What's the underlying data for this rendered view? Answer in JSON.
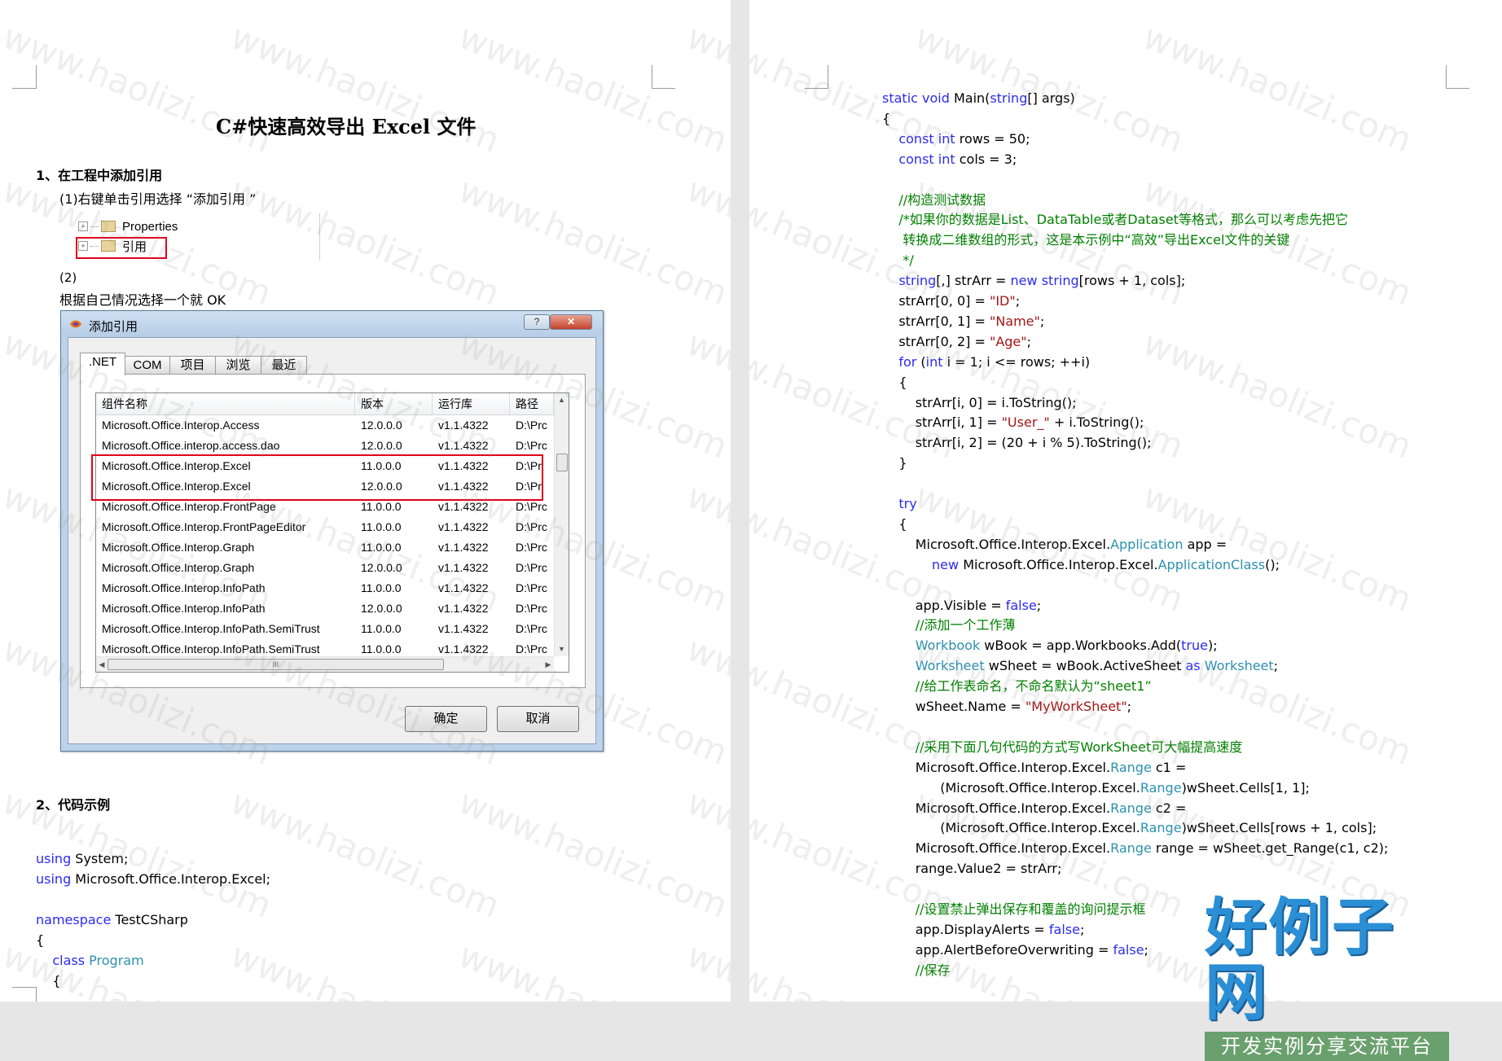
{
  "document": {
    "title": "C#快速高效导出 Excel 文件",
    "section1_heading": "1、在工程中添加引用",
    "step1_text": "(1)右键单击引用选择 “添加引用 ”",
    "tree_items": [
      "Properties",
      "引用"
    ],
    "step2_label": "(2)",
    "step2_text": "根据自己情况选择一个就 OK",
    "section2_heading": "2、代码示例"
  },
  "dialog": {
    "title": "添加引用",
    "help_glyph": "?",
    "close_glyph": "✕",
    "tabs": [
      ".NET",
      "COM",
      "项目",
      "浏览",
      "最近"
    ],
    "selected_tab": ".NET",
    "columns": [
      "组件名称",
      "版本",
      "运行库",
      "路径"
    ],
    "rows": [
      [
        "Microsoft.Office.Interop.Access",
        "12.0.0.0",
        "v1.1.4322",
        "D:\\Prc"
      ],
      [
        "Microsoft.Office.interop.access.dao",
        "12.0.0.0",
        "v1.1.4322",
        "D:\\Prc"
      ],
      [
        "Microsoft.Office.Interop.Excel",
        "11.0.0.0",
        "v1.1.4322",
        "D:\\Pr"
      ],
      [
        "Microsoft.Office.Interop.Excel",
        "12.0.0.0",
        "v1.1.4322",
        "D:\\Pr"
      ],
      [
        "Microsoft.Office.Interop.FrontPage",
        "11.0.0.0",
        "v1.1.4322",
        "D:\\Prc"
      ],
      [
        "Microsoft.Office.Interop.FrontPageEditor",
        "11.0.0.0",
        "v1.1.4322",
        "D:\\Prc"
      ],
      [
        "Microsoft.Office.Interop.Graph",
        "11.0.0.0",
        "v1.1.4322",
        "D:\\Prc"
      ],
      [
        "Microsoft.Office.Interop.Graph",
        "12.0.0.0",
        "v1.1.4322",
        "D:\\Prc"
      ],
      [
        "Microsoft.Office.Interop.InfoPath",
        "11.0.0.0",
        "v1.1.4322",
        "D:\\Prc"
      ],
      [
        "Microsoft.Office.Interop.InfoPath",
        "12.0.0.0",
        "v1.1.4322",
        "D:\\Prc"
      ],
      [
        "Microsoft.Office.Interop.InfoPath.SemiTrust",
        "11.0.0.0",
        "v1.1.4322",
        "D:\\Prc"
      ],
      [
        "Microsoft.Office.Interop.InfoPath.SemiTrust",
        "11.0.0.0",
        "v1.1.4322",
        "D:\\Prc"
      ]
    ],
    "ok_label": "确定",
    "cancel_label": "取消",
    "hscroll_grip": "III"
  },
  "colors": {
    "keyword": "#2b2bf0",
    "type": "#2b91af",
    "string": "#a31515",
    "comment": "#008000",
    "highlight_box": "#e0001a"
  },
  "code_left": [
    [
      [
        "using",
        "keyword"
      ],
      [
        " System;",
        ""
      ]
    ],
    [
      [
        "using",
        "keyword"
      ],
      [
        " Microsoft.Office.Interop.Excel;",
        ""
      ]
    ],
    [],
    [
      [
        "namespace",
        "keyword"
      ],
      [
        " TestCSharp",
        ""
      ]
    ],
    [
      [
        "{",
        ""
      ]
    ],
    [
      [
        "    ",
        ""
      ],
      [
        "class",
        "keyword"
      ],
      [
        " ",
        ""
      ],
      [
        "Program",
        "type"
      ]
    ],
    [
      [
        "    {",
        ""
      ]
    ]
  ],
  "code_right": [
    [
      [
        "static",
        "keyword"
      ],
      [
        " ",
        ""
      ],
      [
        "void",
        "keyword"
      ],
      [
        " Main(",
        ""
      ],
      [
        "string",
        "keyword"
      ],
      [
        "[] args)",
        ""
      ]
    ],
    [
      [
        "{",
        ""
      ]
    ],
    [
      [
        "    ",
        ""
      ],
      [
        "const",
        "keyword"
      ],
      [
        " ",
        ""
      ],
      [
        "int",
        "keyword"
      ],
      [
        " rows = 50;",
        ""
      ]
    ],
    [
      [
        "    ",
        ""
      ],
      [
        "const",
        "keyword"
      ],
      [
        " ",
        ""
      ],
      [
        "int",
        "keyword"
      ],
      [
        " cols = 3;",
        ""
      ]
    ],
    [],
    [
      [
        "    //构造测试数据",
        "comment"
      ]
    ],
    [
      [
        "    /*如果你的数据是List、DataTable或者Dataset等格式，那么可以考虑先把它",
        "comment"
      ]
    ],
    [
      [
        "     转换成二维数组的形式，这是本示例中“高效”导出Excel文件的关键",
        "comment"
      ]
    ],
    [
      [
        "     */",
        "comment"
      ]
    ],
    [
      [
        "    ",
        ""
      ],
      [
        "string",
        "keyword"
      ],
      [
        "[,] strArr = ",
        ""
      ],
      [
        "new",
        "keyword"
      ],
      [
        " ",
        ""
      ],
      [
        "string",
        "keyword"
      ],
      [
        "[rows + 1, cols];",
        ""
      ]
    ],
    [
      [
        "    strArr[0, 0] = ",
        ""
      ],
      [
        "\"ID\"",
        "string"
      ],
      [
        ";",
        ""
      ]
    ],
    [
      [
        "    strArr[0, 1] = ",
        ""
      ],
      [
        "\"Name\"",
        "string"
      ],
      [
        ";",
        ""
      ]
    ],
    [
      [
        "    strArr[0, 2] = ",
        ""
      ],
      [
        "\"Age\"",
        "string"
      ],
      [
        ";",
        ""
      ]
    ],
    [
      [
        "    ",
        ""
      ],
      [
        "for",
        "keyword"
      ],
      [
        " (",
        ""
      ],
      [
        "int",
        "keyword"
      ],
      [
        " i = 1; i <= rows; ++i)",
        ""
      ]
    ],
    [
      [
        "    {",
        ""
      ]
    ],
    [
      [
        "        strArr[i, 0] = i.ToString();",
        ""
      ]
    ],
    [
      [
        "        strArr[i, 1] = ",
        ""
      ],
      [
        "\"User_\"",
        "string"
      ],
      [
        " + i.ToString();",
        ""
      ]
    ],
    [
      [
        "        strArr[i, 2] = (20 + i % 5).ToString();",
        ""
      ]
    ],
    [
      [
        "    }",
        ""
      ]
    ],
    [],
    [
      [
        "    ",
        ""
      ],
      [
        "try",
        "keyword"
      ]
    ],
    [
      [
        "    {",
        ""
      ]
    ],
    [
      [
        "        Microsoft.Office.Interop.Excel.",
        ""
      ],
      [
        "Application",
        "type"
      ],
      [
        " app =",
        ""
      ]
    ],
    [
      [
        "            ",
        ""
      ],
      [
        "new",
        "keyword"
      ],
      [
        " Microsoft.Office.Interop.Excel.",
        ""
      ],
      [
        "ApplicationClass",
        "type"
      ],
      [
        "();",
        ""
      ]
    ],
    [],
    [
      [
        "        app.Visible = ",
        ""
      ],
      [
        "false",
        "keyword"
      ],
      [
        ";",
        ""
      ]
    ],
    [
      [
        "        //添加一个工作薄",
        "comment"
      ]
    ],
    [
      [
        "        ",
        ""
      ],
      [
        "Workbook",
        "type"
      ],
      [
        " wBook = app.Workbooks.Add(",
        ""
      ],
      [
        "true",
        "keyword"
      ],
      [
        ");",
        ""
      ]
    ],
    [
      [
        "        ",
        ""
      ],
      [
        "Worksheet",
        "type"
      ],
      [
        " wSheet = wBook.ActiveSheet ",
        ""
      ],
      [
        "as",
        "keyword"
      ],
      [
        " ",
        ""
      ],
      [
        "Worksheet",
        "type"
      ],
      [
        ";",
        ""
      ]
    ],
    [
      [
        "        //给工作表命名，不命名默认为“sheet1”",
        "comment"
      ]
    ],
    [
      [
        "        wSheet.Name = ",
        ""
      ],
      [
        "\"MyWorkSheet\"",
        "string"
      ],
      [
        ";",
        ""
      ]
    ],
    [],
    [
      [
        "        //采用下面几句代码的方式写WorkSheet可大幅提高速度",
        "comment"
      ]
    ],
    [
      [
        "        Microsoft.Office.Interop.Excel.",
        ""
      ],
      [
        "Range",
        "type"
      ],
      [
        " c1 =",
        ""
      ]
    ],
    [
      [
        "              (Microsoft.Office.Interop.Excel.",
        ""
      ],
      [
        "Range",
        "type"
      ],
      [
        ")wSheet.Cells[1, 1];",
        ""
      ]
    ],
    [
      [
        "        Microsoft.Office.Interop.Excel.",
        ""
      ],
      [
        "Range",
        "type"
      ],
      [
        " c2 =",
        ""
      ]
    ],
    [
      [
        "              (Microsoft.Office.Interop.Excel.",
        ""
      ],
      [
        "Range",
        "type"
      ],
      [
        ")wSheet.Cells[rows + 1, cols];",
        ""
      ]
    ],
    [
      [
        "        Microsoft.Office.Interop.Excel.",
        ""
      ],
      [
        "Range",
        "type"
      ],
      [
        " range = wSheet.get_Range(c1, c2);",
        ""
      ]
    ],
    [
      [
        "        range.Value2 = strArr;",
        ""
      ]
    ],
    [],
    [
      [
        "        //设置禁止弹出保存和覆盖的询问提示框",
        "comment"
      ]
    ],
    [
      [
        "        app.DisplayAlerts = ",
        ""
      ],
      [
        "false",
        "keyword"
      ],
      [
        ";",
        ""
      ]
    ],
    [
      [
        "        app.AlertBeforeOverwriting = ",
        ""
      ],
      [
        "false",
        "keyword"
      ],
      [
        ";",
        ""
      ]
    ],
    [
      [
        "        //保存",
        "comment"
      ]
    ]
  ],
  "watermark_text": "www.haolizi.com",
  "brand": {
    "name": "好例子网",
    "tagline": "开发实例分享交流平台"
  }
}
